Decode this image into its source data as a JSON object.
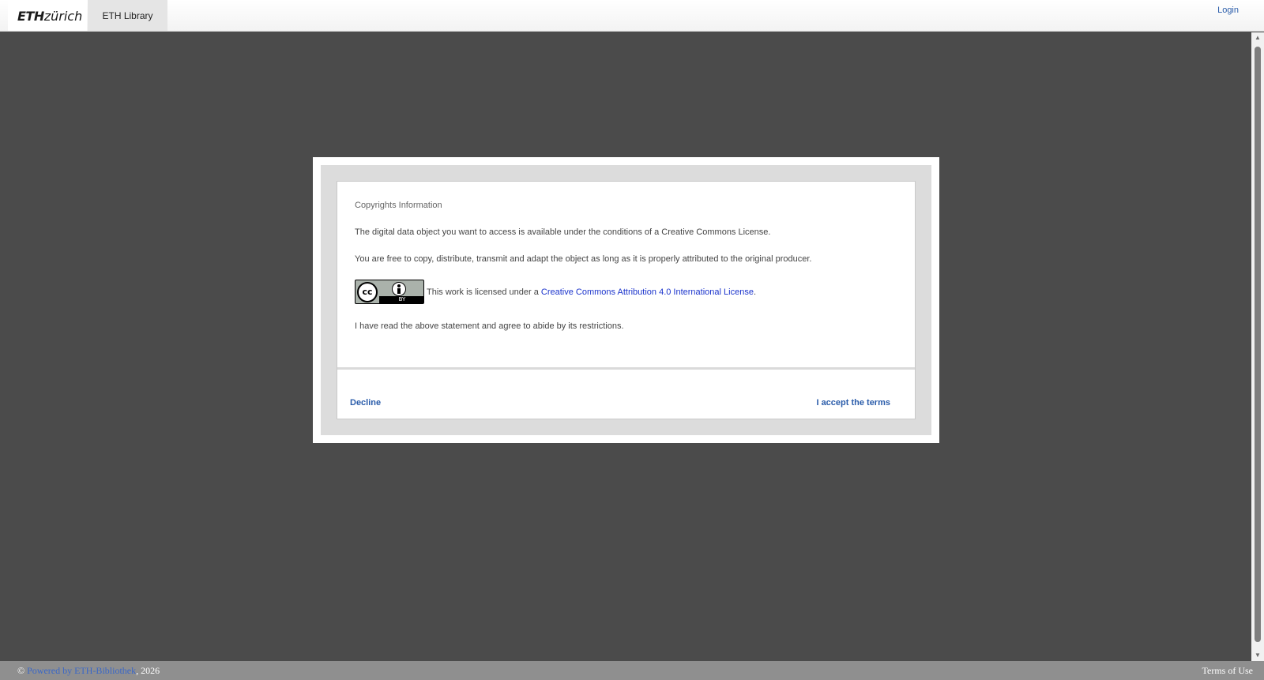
{
  "header": {
    "logo_bold": "ETH",
    "logo_rest": "zürich",
    "tab_label": "ETH Library",
    "login_label": "Login"
  },
  "dialog": {
    "title": "Copyrights Information",
    "paragraph1": "The digital data object you want to access is available under the conditions of a Creative Commons License.",
    "paragraph2": "You are free to copy, distribute, transmit and adapt the object as long as it is properly attributed to the original producer.",
    "license_prefix": "This work is licensed under a ",
    "license_link": "Creative Commons Attribution 4.0 International License",
    "license_suffix": ".",
    "badge_cc": "cc",
    "badge_by": "BY",
    "agreement": "I have read the above statement and agree to abide by its restrictions.",
    "decline_label": "Decline",
    "accept_label": "I accept the terms"
  },
  "footer": {
    "copyright_symbol": "© ",
    "powered_link": "Powered by ETH-Bibliothek",
    "year": ", 2026",
    "terms_label": "Terms of Use"
  }
}
